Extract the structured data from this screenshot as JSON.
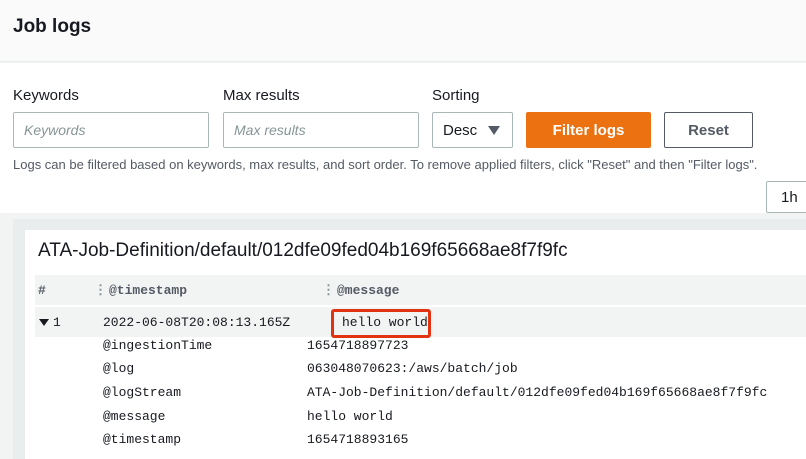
{
  "header": {
    "title": "Job logs"
  },
  "filters": {
    "keywords_label": "Keywords",
    "keywords_placeholder": "Keywords",
    "max_results_label": "Max results",
    "max_results_placeholder": "Max results",
    "sorting_label": "Sorting",
    "sorting_value": "Desc",
    "filter_button": "Filter logs",
    "reset_button": "Reset",
    "help_text": "Logs can be filtered based on keywords, max results, and sort order. To remove applied filters, click \"Reset\" and then \"Filter logs\"."
  },
  "time_range": {
    "selected": "1h"
  },
  "log_group": {
    "title": "ATA-Job-Definition/default/012dfe09fed04b169f65668ae8f7f9fc",
    "columns": [
      "#",
      "@timestamp",
      "@message"
    ],
    "rows": [
      {
        "index": "1",
        "timestamp": "2022-06-08T20:08:13.165Z",
        "message": "hello world",
        "details": [
          {
            "key": "@ingestionTime",
            "value": "1654718897723"
          },
          {
            "key": "@log",
            "value": "063048070623:/aws/batch/job"
          },
          {
            "key": "@logStream",
            "value": "ATA-Job-Definition/default/012dfe09fed04b169f65668ae8f7f9fc"
          },
          {
            "key": "@message",
            "value": "hello world"
          },
          {
            "key": "@timestamp",
            "value": "1654718893165"
          }
        ]
      }
    ]
  },
  "colors": {
    "primary_button": "#ec7211",
    "highlight_border": "#df3312"
  }
}
